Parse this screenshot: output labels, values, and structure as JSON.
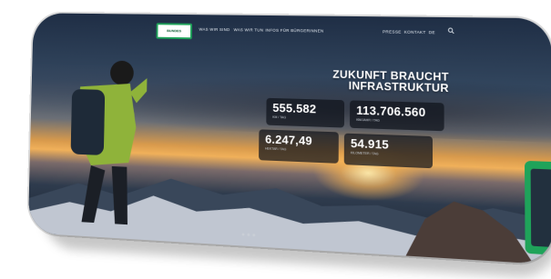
{
  "nav": {
    "logo_text": "BUNDES",
    "links": [
      "WAS WIR SIND",
      "WAS WIR TUN",
      "INFOS FÜR BÜRGERINNEN"
    ],
    "right_links": [
      "PRESSE",
      "KONTAKT",
      "DE"
    ]
  },
  "hero": {
    "headline_line1": "ZUKUNFT BRAUCHT",
    "headline_line2": "INFRASTRUKTUR"
  },
  "stats": [
    {
      "value": "555.582",
      "label": "KM / TAG"
    },
    {
      "value": "113.706.560",
      "label": "KM/JAHR / TAG"
    },
    {
      "value": "6.247,49",
      "label": "HEKTAR / TAG"
    },
    {
      "value": "54.915",
      "label": "KILOMETER / TAG"
    }
  ],
  "colors": {
    "accent_green": "#1fa35a",
    "stat_bg": "#0f141c"
  }
}
